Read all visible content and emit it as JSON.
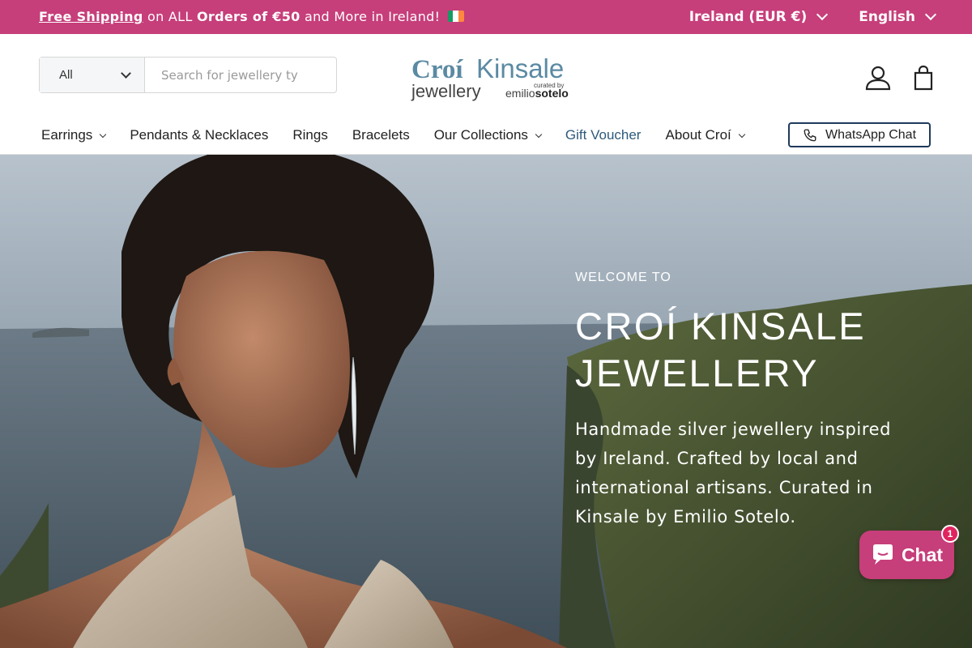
{
  "announcement": {
    "shipping_link": "Free Shipping",
    "text_1": " on ALL ",
    "bold": "Orders of €50",
    "text_2": " and More in Ireland!",
    "flag_colors": [
      "#169b62",
      "#ffffff",
      "#ff883e"
    ]
  },
  "locale": {
    "country": "Ireland (EUR €)",
    "language": "English"
  },
  "search": {
    "category": "All",
    "placeholder": "Search for jewellery ty"
  },
  "logo": {
    "brand_1": "Croí",
    "brand_2": "Kinsale",
    "subtitle": "jewellery",
    "curated": "curated by",
    "curator_1": "emilio",
    "curator_2": "sotelo"
  },
  "header_icons": [
    "account-icon",
    "bag-icon"
  ],
  "nav": {
    "items": [
      {
        "label": "Earrings",
        "dropdown": true
      },
      {
        "label": "Pendants & Necklaces",
        "dropdown": false
      },
      {
        "label": "Rings",
        "dropdown": false
      },
      {
        "label": "Bracelets",
        "dropdown": false
      },
      {
        "label": "Our Collections",
        "dropdown": true
      },
      {
        "label": "Gift Voucher",
        "dropdown": false
      },
      {
        "label": "About Croí",
        "dropdown": true
      }
    ],
    "whatsapp_label": "WhatsApp Chat"
  },
  "hero": {
    "welcome": "WELCOME TO",
    "title_line_1": "CROÍ KINSALE",
    "title_line_2": "JEWELLERY",
    "description": "Handmade silver jewellery inspired by Ireland. Crafted by local and international artisans. Curated in Kinsale by Emilio Sotelo."
  },
  "chat": {
    "label": "Chat",
    "badge": "1"
  },
  "colors": {
    "accent": "#c63e7a",
    "logo_blue": "#5b8aa3",
    "nav_blue": "#2d5a7b",
    "whatsapp_border": "#1f3a5c"
  }
}
